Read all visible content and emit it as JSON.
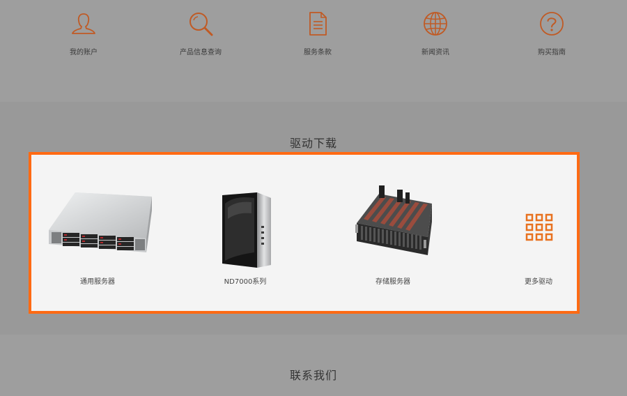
{
  "nav": {
    "items": [
      {
        "label": "我的账户",
        "icon": "user-icon"
      },
      {
        "label": "产品信息查询",
        "icon": "search-icon"
      },
      {
        "label": "服务条款",
        "icon": "document-icon"
      },
      {
        "label": "新闻资讯",
        "icon": "globe-icon"
      },
      {
        "label": "购买指南",
        "icon": "help-icon"
      }
    ]
  },
  "drivers": {
    "title": "驱动下载",
    "items": [
      {
        "label": "通用服务器",
        "icon": "rack-server-image"
      },
      {
        "label": "ND7000系列",
        "icon": "tower-server-image"
      },
      {
        "label": "存储服务器",
        "icon": "storage-server-image"
      },
      {
        "label": "更多驱动",
        "icon": "grid-icon"
      }
    ]
  },
  "contact": {
    "title": "联系我们"
  },
  "colors": {
    "accent": "#ff6a13",
    "icon": "#c05a24",
    "overlay": "#9e9e9e"
  }
}
